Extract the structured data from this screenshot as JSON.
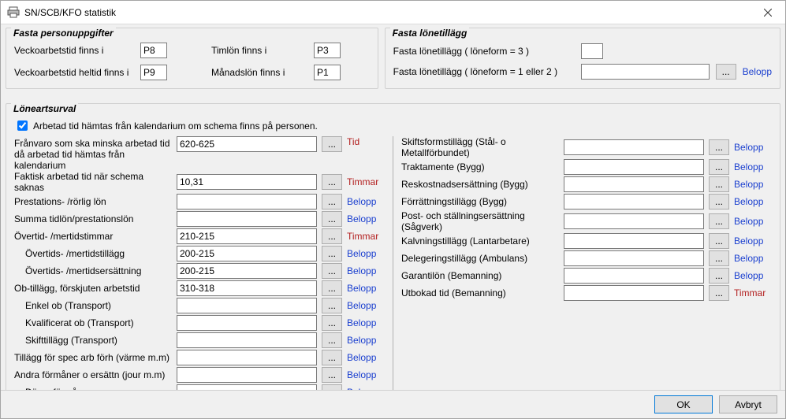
{
  "window": {
    "title": "SN/SCB/KFO statistik"
  },
  "unit_labels": {
    "tid": "Tid",
    "timmar": "Timmar",
    "belopp": "Belopp"
  },
  "ellipsis": "...",
  "buttons": {
    "ok": "OK",
    "cancel": "Avbryt"
  },
  "fasta_person": {
    "legend": "Fasta personuppgifter",
    "veckoarbetstid_label": "Veckoarbetstid finns i",
    "veckoarbetstid_val": "P8",
    "timlon_label": "Timlön finns i",
    "timlon_val": "P3",
    "veckoheltid_label": "Veckoarbetstid heltid finns i",
    "veckoheltid_val": "P9",
    "manadslon_label": "Månadslön finns i",
    "manadslon_val": "P1"
  },
  "fasta_lonet": {
    "legend": "Fasta lönetillägg",
    "row1_label": "Fasta lönetillägg  ( löneform = 3 )",
    "row1_val": "",
    "row2_label": "Fasta lönetillägg  ( löneform = 1 eller 2 )",
    "row2_val": ""
  },
  "loneart": {
    "legend": "Löneartsurval",
    "checkbox_label": "Arbetad tid hämtas från kalendarium om schema finns på personen.",
    "checkbox_checked": true,
    "left": [
      {
        "label": "Frånvaro som ska minska arbetad tid då arbetad tid hämtas från kalendarium",
        "value": "620-625",
        "unit": "tid",
        "tall": true
      },
      {
        "label": "Faktisk arbetad tid när schema saknas",
        "value": "10,31",
        "unit": "timmar"
      },
      {
        "label": "Prestations- /rörlig lön",
        "value": "",
        "unit": "belopp"
      },
      {
        "label": "Summa tidlön/prestationslön",
        "value": "",
        "unit": "belopp"
      },
      {
        "label": "Övertid- /mertidstimmar",
        "value": "210-215",
        "unit": "timmar"
      },
      {
        "label": "Övertids- /mertidstillägg",
        "value": "200-215",
        "unit": "belopp",
        "indent": true
      },
      {
        "label": "Övertids- /mertidsersättning",
        "value": "200-215",
        "unit": "belopp",
        "indent": true
      },
      {
        "label": "Ob-tillägg, förskjuten arbetstid",
        "value": "310-318",
        "unit": "belopp"
      },
      {
        "label": "Enkel ob (Transport)",
        "value": "",
        "unit": "belopp",
        "indent": true
      },
      {
        "label": "Kvalificerat ob (Transport)",
        "value": "",
        "unit": "belopp",
        "indent": true
      },
      {
        "label": "Skifttillägg (Transport)",
        "value": "",
        "unit": "belopp",
        "indent": true
      },
      {
        "label": "Tillägg för spec arb förh (värme m.m)",
        "value": "",
        "unit": "belopp"
      },
      {
        "label": "Andra förmåner o ersättn (jour m.m)",
        "value": "",
        "unit": "belopp"
      },
      {
        "label": "Därav förmåner",
        "value": "",
        "unit": "belopp",
        "indent": true
      }
    ],
    "right": [
      {
        "label": "Skiftsformstillägg (Stål- o Metallförbundet)",
        "value": "",
        "unit": "belopp"
      },
      {
        "label": "Traktamente (Bygg)",
        "value": "",
        "unit": "belopp"
      },
      {
        "label": "Reskostnadsersättning (Bygg)",
        "value": "",
        "unit": "belopp"
      },
      {
        "label": "Förrättningstillägg (Bygg)",
        "value": "",
        "unit": "belopp"
      },
      {
        "label": "Post- och ställningsersättning (Sågverk)",
        "value": "",
        "unit": "belopp"
      },
      {
        "label": "Kalvningstillägg (Lantarbetare)",
        "value": "",
        "unit": "belopp"
      },
      {
        "label": "Delegeringstillägg (Ambulans)",
        "value": "",
        "unit": "belopp"
      },
      {
        "label": "Garantilön (Bemanning)",
        "value": "",
        "unit": "belopp"
      },
      {
        "label": "Utbokad tid (Bemanning)",
        "value": "",
        "unit": "timmar"
      }
    ]
  }
}
